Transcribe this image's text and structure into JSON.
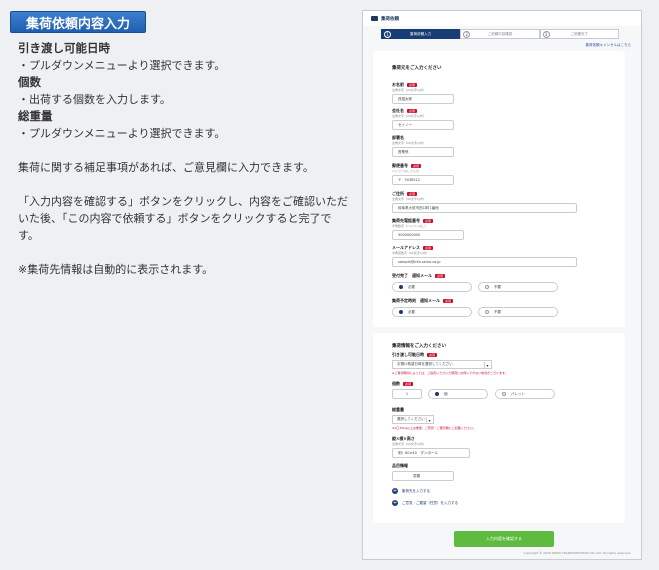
{
  "badge": "集荷依頼内容入力",
  "instructions": {
    "h1": "引き渡し可能日時",
    "t1": "・プルダウンメニューより選択できます。",
    "h2": "個数",
    "t2": "・出荷する個数を入力します。",
    "h3": "総重量",
    "t3": "・プルダウンメニューより選択できます。",
    "p1": "集荷に関する補足事項があれば、ご意見欄に入力できます。",
    "p2": "「入力内容を確認する」ボタンをクリックし、内容をご確認いただいた後、「この内容で依頼する」ボタンをクリックすると完了です。",
    "p3": "※集荷先情報は自動的に表示されます。"
  },
  "mock": {
    "header": "集荷依頼",
    "steps": [
      {
        "num": "1",
        "label": "集荷依頼入力"
      },
      {
        "num": "2",
        "label": "ご依頼内容確認"
      },
      {
        "num": "3",
        "label": "ご依頼完了"
      }
    ],
    "cancel_link": "集荷依頼キャンセルはこちら",
    "req_badge": "必須",
    "sec1": {
      "title": "集荷元をご入力ください",
      "name_label": "お名前",
      "name_hint": "全角文字（20文字以内）",
      "name_value": "西濃太郎",
      "company_label": "会社名",
      "company_hint": "全角文字（20文字以内）",
      "company_value": "セイノー",
      "dept_label": "部署名",
      "dept_hint": "全角文字（20文字以内）",
      "dept_value": "営業係",
      "zip_label": "郵便番号",
      "zip_hint": "ハイフンなしで入力",
      "zip_value": "5038512",
      "addr_label": "ご住所",
      "addr_hint": "全角文字（40文字以内）",
      "addr_value": "岐阜県大垣市田口町1番地",
      "tel_label": "集荷先電話番号",
      "tel_hint": "半角数字（ハイフンなし）",
      "tel_value": "0000000000",
      "mail_label": "メールアドレス",
      "mail_hint": "半角英数字（60文字以内）",
      "mail_value": "sample@info.seino.co.jp",
      "notify1_label": "受付完了　通知メール",
      "notify2_label": "集荷予定時刻　通知メール",
      "opt_need": "必要",
      "opt_noneed": "不要"
    },
    "sec2": {
      "title": "集荷情報をご入力ください",
      "date_label": "引き渡し可能日時",
      "date_value": "お預け希望日時を選択してください",
      "date_note": "※ご希望時間によっては、ご指定いただいた時刻にお伺いできない場合がございます。",
      "count_label": "個数",
      "count_value": "1",
      "unit_ko": "個",
      "unit_pallet": "パレット",
      "weight_label": "総重量",
      "weight_value": "選択してください",
      "weight_note": "※1口30kg以上は重量、ご意見・ご要望欄にご記載ください。",
      "size_label": "縦×横×高さ",
      "size_hint": "全角文字（20文字以内）",
      "size_value": "例）60×40　ダンボール",
      "goods_label": "品目情報",
      "goods_value": "書類",
      "link1": "集荷先を入力する",
      "link2": "ご意見・ご要望（任意）を入力する"
    },
    "confirm_button": "入力内容を確認する",
    "copyright": "Copyright © 2018 SEINO TRANSPORTATION CO.,Ltd. All rights reserved."
  }
}
